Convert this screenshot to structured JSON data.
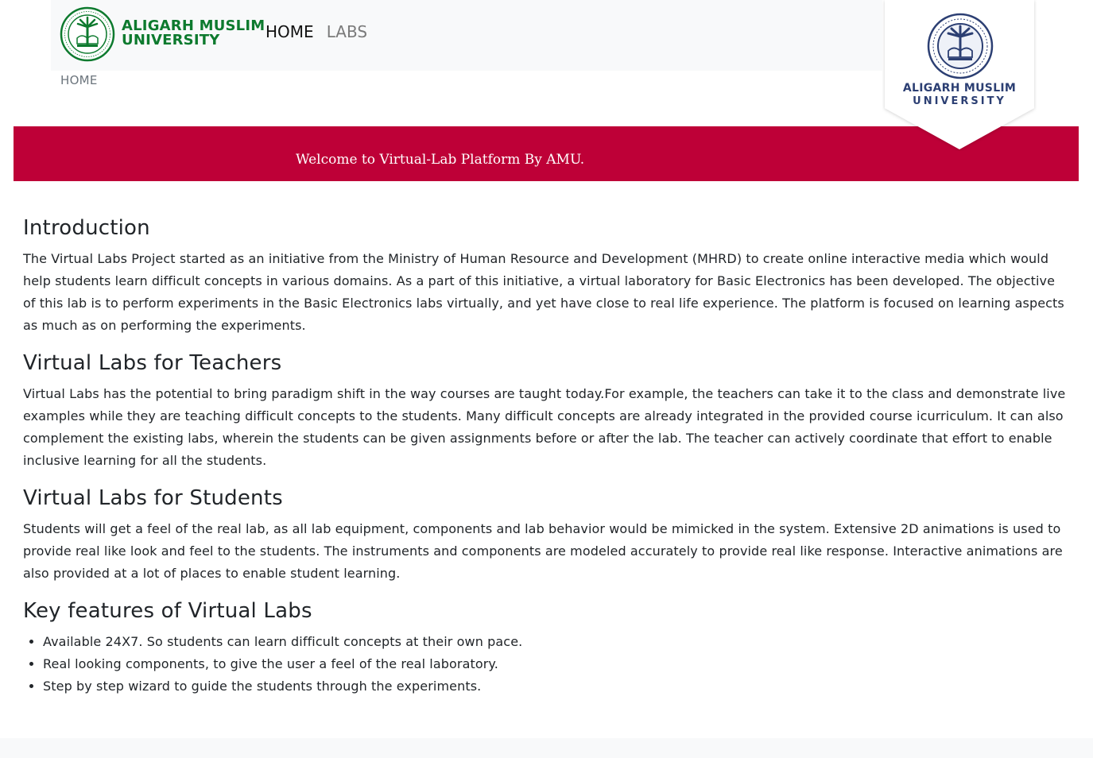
{
  "navbar": {
    "brand_line1": "ALIGARH MUSLIM",
    "brand_line2": "UNIVERSITY",
    "links": [
      {
        "label": "HOME"
      },
      {
        "label": "LABS"
      }
    ]
  },
  "breadcrumb": "HOME",
  "badge": {
    "line1": "ALIGARH MUSLIM",
    "line2": "UNIVERSITY"
  },
  "banner": {
    "text": "Welcome to Virtual-Lab Platform By AMU."
  },
  "sections": {
    "introduction": {
      "heading": "Introduction",
      "text": "The Virtual Labs Project started as an initiative from the Ministry of Human Resource and Development (MHRD) to create online interactive media which would help students learn difficult concepts in various domains. As a part of this initiative, a virtual laboratory for Basic Electronics has been developed. The objective of this lab is to perform experiments in the Basic Electronics labs virtually, and yet have close to real life experience. The platform is focused on learning aspects as much as on performing the experiments."
    },
    "teachers": {
      "heading": "Virtual Labs for Teachers",
      "text": "Virtual Labs has the potential to bring paradigm shift in the way courses are taught today.For example, the teachers can take it to the class and demonstrate live examples while they are teaching difficult concepts to the students. Many difficult concepts are already integrated in the provided course icurriculum. It can also complement the existing labs, wherein the students can be given assignments before or after the lab. The teacher can actively coordinate that effort to enable inclusive learning for all the students."
    },
    "students": {
      "heading": "Virtual Labs for Students",
      "text": "Students will get a feel of the real lab, as all lab equipment, components and lab behavior would be mimicked in the system. Extensive 2D animations is used to provide real like look and feel to the students. The instruments and components are modeled accurately to provide real like response. Interactive animations are also provided at a lot of places to enable student learning."
    },
    "features": {
      "heading": "Key features of Virtual Labs",
      "items": [
        "Available 24X7. So students can learn difficult concepts at their own pace.",
        "Real looking components, to give the user a feel of the real laboratory.",
        "Step by step wizard to guide the students through the experiments."
      ]
    }
  },
  "colors": {
    "banner": "#be0037",
    "brand_green": "#0d7a2e",
    "badge_navy": "#2c3f73",
    "navbar_bg": "#f8f9fa"
  },
  "icons": {
    "brand_logo": "amu-emblem-green-icon",
    "badge_logo": "amu-emblem-navy-icon"
  }
}
